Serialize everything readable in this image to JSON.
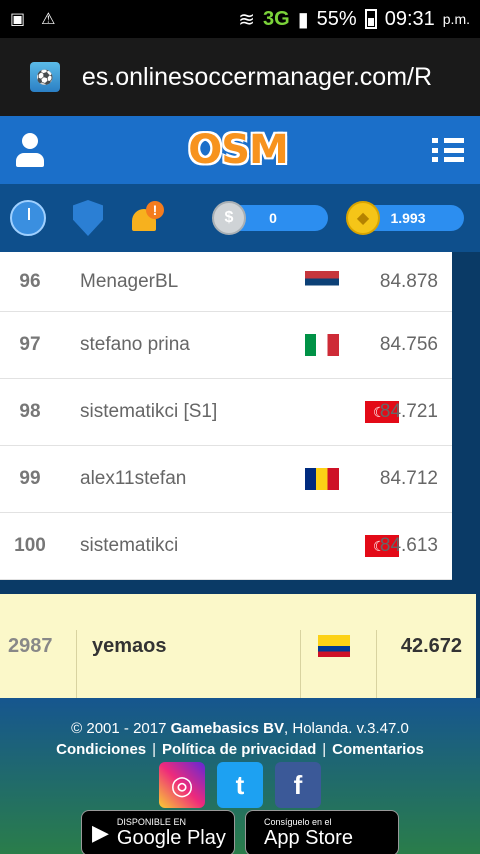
{
  "status_bar": {
    "network": "3G",
    "battery": "55%",
    "time": "09:31",
    "ampm": "p.m."
  },
  "browser": {
    "url": "es.onlinesoccermanager.com/R"
  },
  "header": {
    "logo": "OSM"
  },
  "toolbar": {
    "alert_badge": "!",
    "coins_silver": "0",
    "coins_gold": "1.993"
  },
  "ranking": [
    {
      "rank": "96",
      "name": "MenagerBL",
      "flag": "rs",
      "points": "84.878"
    },
    {
      "rank": "97",
      "name": "stefano prina",
      "flag": "it",
      "points": "84.756"
    },
    {
      "rank": "98",
      "name": "sistematikci [S1]",
      "flag": "tr",
      "points": "84.721"
    },
    {
      "rank": "99",
      "name": "alex11stefan",
      "flag": "ro",
      "points": "84.712"
    },
    {
      "rank": "100",
      "name": "sistematikci",
      "flag": "tr",
      "points": "84.613"
    }
  ],
  "current_user": {
    "rank": "2987",
    "name": "yemaos",
    "flag": "co",
    "points": "42.672"
  },
  "footer": {
    "copyright_prefix": "© 2001 - 2017 ",
    "company": "Gamebasics BV",
    "copyright_suffix": ", Holanda. v.3.47.0",
    "link_terms": "Condiciones",
    "link_privacy": "Política de privacidad",
    "link_comments": "Comentarios",
    "google_small": "DISPONIBLE EN",
    "google_big": "Google Play",
    "apple_small": "Consíguelo en el",
    "apple_big": "App Store"
  }
}
